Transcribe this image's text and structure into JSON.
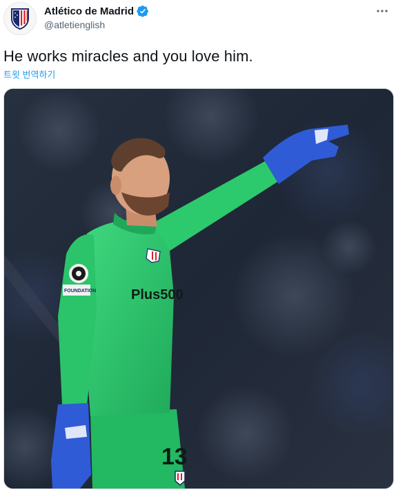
{
  "account": {
    "display_name": "Atlético de Madrid",
    "handle": "@atletienglish",
    "verified": true,
    "avatar_icon": "atletico-crest-icon"
  },
  "tweet": {
    "text": "He works miracles and you love him.",
    "translate_label": "트윗 번역하기"
  },
  "menu": {
    "more_icon": "more-horizontal-icon"
  },
  "media": {
    "kind": "photo",
    "subject": "goalkeeper-pointing",
    "sponsor_text": "Plus500",
    "shirt_number": "13",
    "sleeve_badge_text": "FOUNDATION",
    "colors": {
      "kit": "#27c46c",
      "glove": "#2f5bd6",
      "crowd": "#1f2636"
    }
  },
  "colors": {
    "link": "#1d9bf0",
    "verified": "#1d9bf0",
    "secondary_text": "#536471"
  }
}
